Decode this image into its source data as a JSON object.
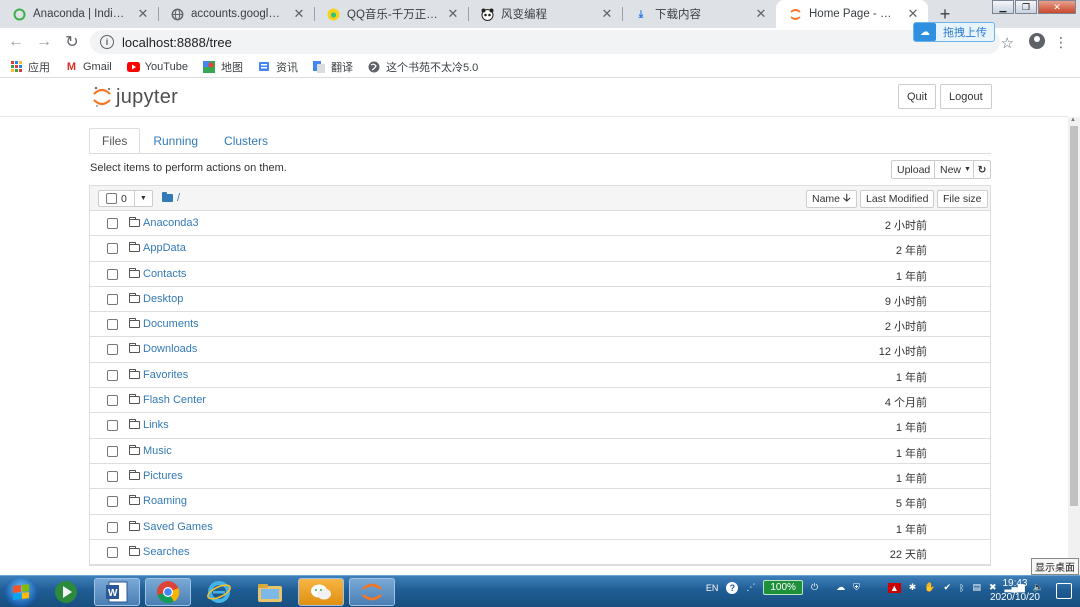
{
  "browser": {
    "tabs": [
      {
        "title": "Anaconda | Individual",
        "icon": "anaconda-icon",
        "active": false
      },
      {
        "title": "accounts.google.com",
        "icon": "globe-icon",
        "active": false
      },
      {
        "title": "QQ音乐-千万正版音乐海",
        "icon": "qq-music-icon",
        "active": false
      },
      {
        "title": "风变编程",
        "icon": "panda-icon",
        "active": false
      },
      {
        "title": "下载内容",
        "icon": "download-icon",
        "active": false
      },
      {
        "title": "Home Page - Select or",
        "icon": "jupyter-icon",
        "active": true
      }
    ],
    "url": "localhost:8888/tree",
    "baidu_upload_label": "拖拽上传",
    "bookmarks": [
      {
        "label": "应用",
        "icon": "apps-grid-icon"
      },
      {
        "label": "Gmail",
        "icon": "gmail-icon"
      },
      {
        "label": "YouTube",
        "icon": "youtube-icon"
      },
      {
        "label": "地图",
        "icon": "maps-icon"
      },
      {
        "label": "资讯",
        "icon": "news-icon"
      },
      {
        "label": "翻译",
        "icon": "translate-icon"
      },
      {
        "label": "这个书苑不太冷5.0",
        "icon": "globe-icon"
      }
    ]
  },
  "jupyter": {
    "logo_text": "jupyter",
    "quit_label": "Quit",
    "logout_label": "Logout",
    "tabs": [
      "Files",
      "Running",
      "Clusters"
    ],
    "hint": "Select items to perform actions on them.",
    "upload_label": "Upload",
    "new_label": "New",
    "selected_count": "0",
    "breadcrumb": "/",
    "columns": {
      "name": "Name",
      "last_modified": "Last Modified",
      "file_size": "File size"
    },
    "items": [
      {
        "name": "Anaconda3",
        "modified": "2 小时前"
      },
      {
        "name": "AppData",
        "modified": "2 年前"
      },
      {
        "name": "Contacts",
        "modified": "1 年前"
      },
      {
        "name": "Desktop",
        "modified": "9 小时前"
      },
      {
        "name": "Documents",
        "modified": "2 小时前"
      },
      {
        "name": "Downloads",
        "modified": "12 小时前"
      },
      {
        "name": "Favorites",
        "modified": "1 年前"
      },
      {
        "name": "Flash Center",
        "modified": "4 个月前"
      },
      {
        "name": "Links",
        "modified": "1 年前"
      },
      {
        "name": "Music",
        "modified": "1 年前"
      },
      {
        "name": "Pictures",
        "modified": "1 年前"
      },
      {
        "name": "Roaming",
        "modified": "5 年前"
      },
      {
        "name": "Saved Games",
        "modified": "1 年前"
      },
      {
        "name": "Searches",
        "modified": "22 天前"
      }
    ]
  },
  "taskbar": {
    "show_desktop": "显示桌面",
    "language": "EN",
    "battery": "100%",
    "time": "19:43",
    "date": "2020/10/20",
    "apps": [
      "word-icon",
      "chrome-icon",
      "ie-icon",
      "explorer-icon",
      "wechat-icon",
      "jupyter-icon"
    ]
  },
  "colors": {
    "link": "#337ab7",
    "jupyter_orange": "#f37726",
    "taskbar": "#1f5d94"
  }
}
